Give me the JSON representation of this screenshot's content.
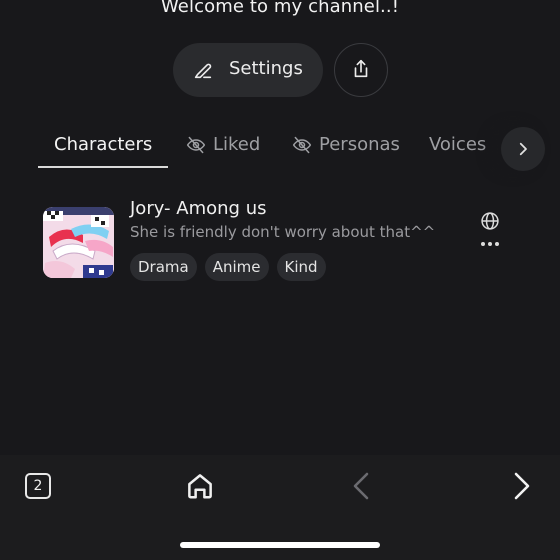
{
  "profile": {
    "welcome_text": "Welcome to my channel..!"
  },
  "actions": {
    "settings_label": "Settings",
    "settings_icon": "pencil-icon",
    "share_icon": "share-icon"
  },
  "tabs": [
    {
      "label": "Characters",
      "active": true
    },
    {
      "label": "Liked",
      "icon": "eye-off-icon"
    },
    {
      "label": "Personas",
      "icon": "eye-off-icon"
    },
    {
      "label": "Voices"
    }
  ],
  "character": {
    "name": "Jory- Among us",
    "description": "She is friendly don't worry about that^^",
    "tags": [
      "Drama",
      "Anime",
      "Kind"
    ],
    "visibility_icon": "globe-icon",
    "menu_icon": "more-dots-icon"
  },
  "browser_bar": {
    "tab_count": "2",
    "home_icon": "home-icon",
    "back_icon": "chevron-left-icon",
    "forward_icon": "chevron-right-icon"
  },
  "colors": {
    "background": "#18181b",
    "pill": "#2a2b2e",
    "text_primary": "#ececec",
    "text_muted": "#9e9fa3"
  }
}
